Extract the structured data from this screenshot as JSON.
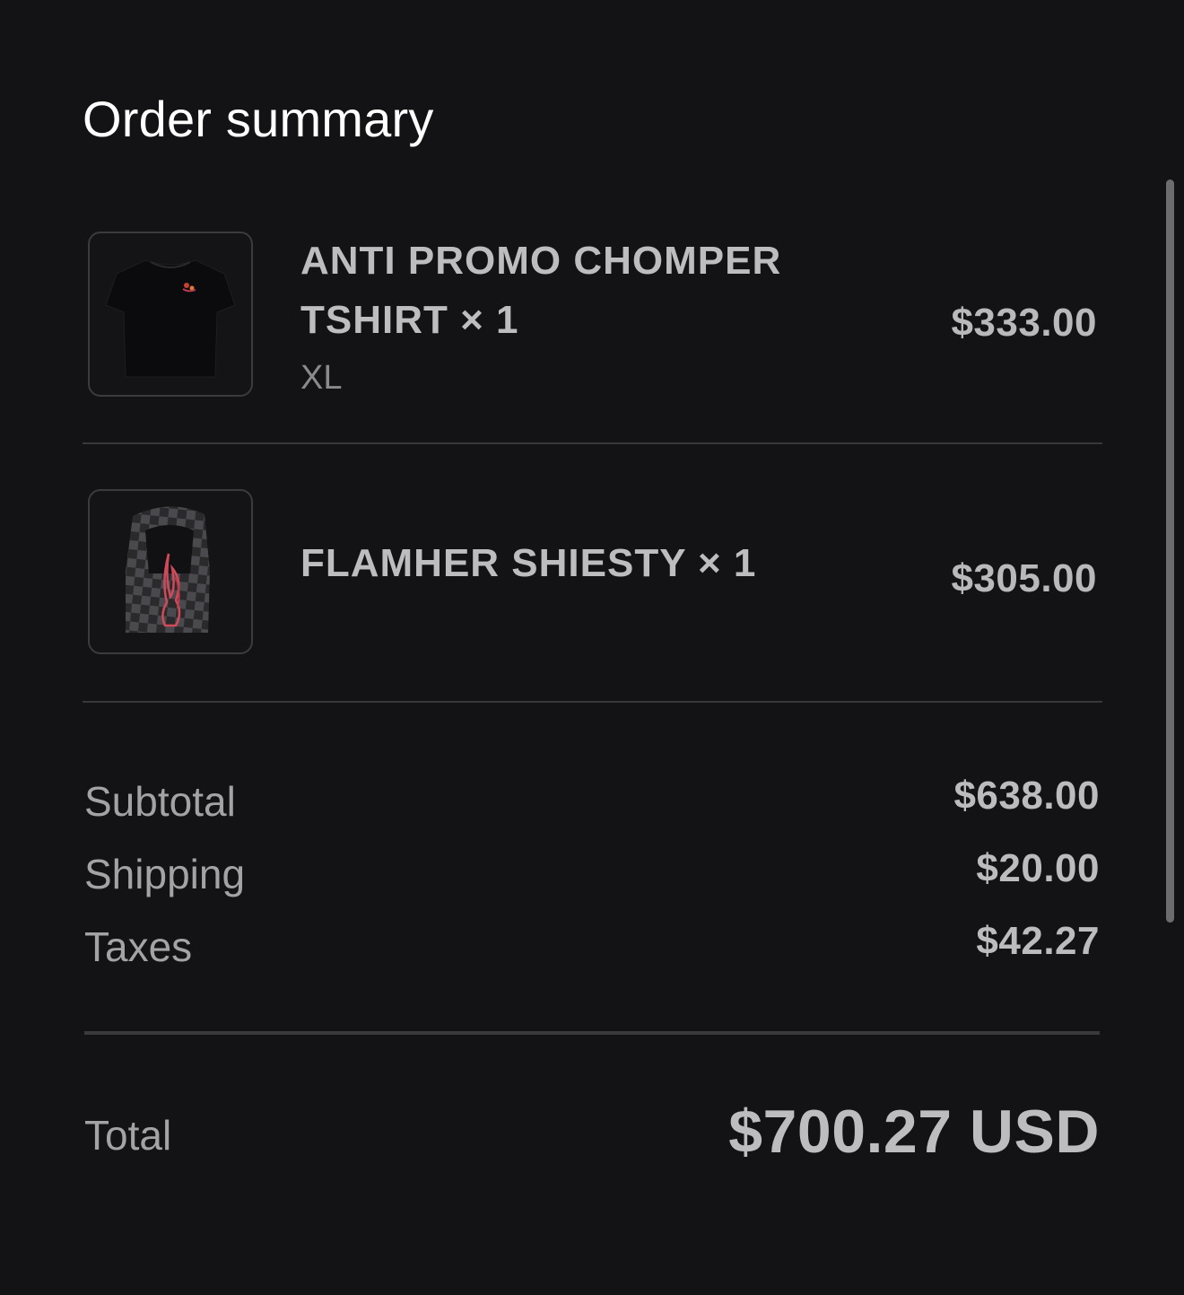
{
  "title": "Order summary",
  "items": [
    {
      "name_line1": "ANTI PROMO CHOMPER",
      "name_line2": "TSHIRT × 1",
      "variant": "XL",
      "price": "$333.00",
      "thumbnail": "black-tshirt-image"
    },
    {
      "name_line1": "FLAMHER SHIESTY × 1",
      "price": "$305.00",
      "thumbnail": "checkered-hood-with-flame-image"
    }
  ],
  "summary": {
    "subtotal_label": "Subtotal",
    "subtotal_value": "$638.00",
    "shipping_label": "Shipping",
    "shipping_value": "$20.00",
    "taxes_label": "Taxes",
    "taxes_value": "$42.27"
  },
  "total": {
    "label": "Total",
    "value": "$700.27 USD"
  },
  "colors": {
    "background": "#131316",
    "title": "#ffffff",
    "text": "#bdbdbf",
    "muted": "#8a8a8d",
    "divider": "#38383c"
  }
}
